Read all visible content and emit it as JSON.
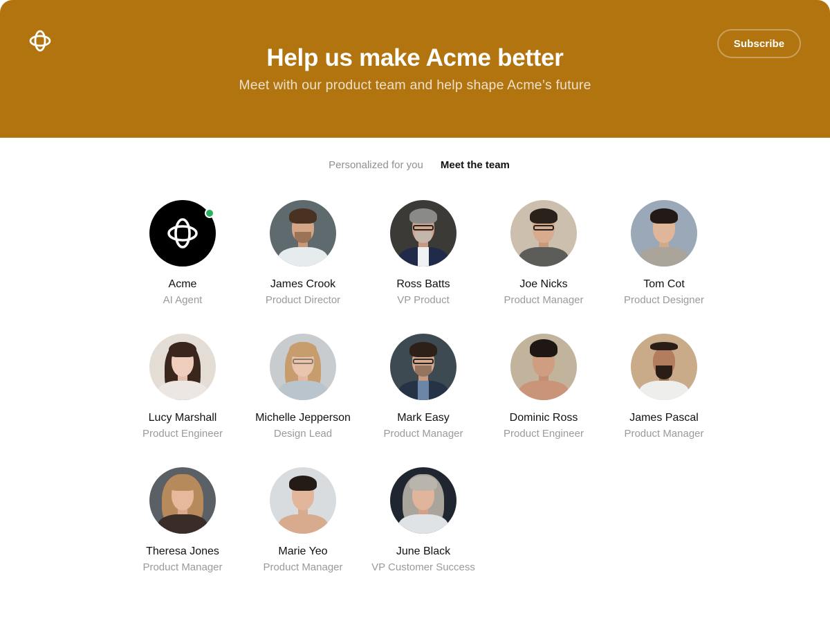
{
  "header": {
    "logo_icon": "acme-orbit-icon",
    "title": "Help us make Acme better",
    "subtitle": "Meet with our product team and help shape Acme’s future",
    "subscribe_label": "Subscribe"
  },
  "tabs": [
    {
      "label": "Personalized for you",
      "active": false
    },
    {
      "label": "Meet the team",
      "active": true
    }
  ],
  "colors": {
    "hero_bg": "#b1740f",
    "online_status": "#2bb05b",
    "name_text": "#111111",
    "role_text": "#9a9a9a"
  },
  "team": [
    {
      "name": "Acme",
      "role": "AI Agent",
      "avatar": "acme-logo",
      "online": true
    },
    {
      "name": "James Crook",
      "role": "Product Director",
      "avatar": "photo"
    },
    {
      "name": "Ross Batts",
      "role": "VP Product",
      "avatar": "photo"
    },
    {
      "name": "Joe Nicks",
      "role": "Product Manager",
      "avatar": "photo"
    },
    {
      "name": "Tom Cot",
      "role": "Product Designer",
      "avatar": "photo"
    },
    {
      "name": "Lucy Marshall",
      "role": "Product Engineer",
      "avatar": "photo"
    },
    {
      "name": "Michelle Jepperson",
      "role": "Design Lead",
      "avatar": "photo"
    },
    {
      "name": "Mark Easy",
      "role": "Product Manager",
      "avatar": "photo"
    },
    {
      "name": "Dominic Ross",
      "role": "Product Engineer",
      "avatar": "photo"
    },
    {
      "name": "James Pascal",
      "role": "Product Manager",
      "avatar": "photo"
    },
    {
      "name": "Theresa Jones",
      "role": "Product Manager",
      "avatar": "photo"
    },
    {
      "name": "Marie Yeo",
      "role": "Product Manager",
      "avatar": "photo"
    },
    {
      "name": "June Black",
      "role": "VP Customer Success",
      "avatar": "photo"
    }
  ]
}
